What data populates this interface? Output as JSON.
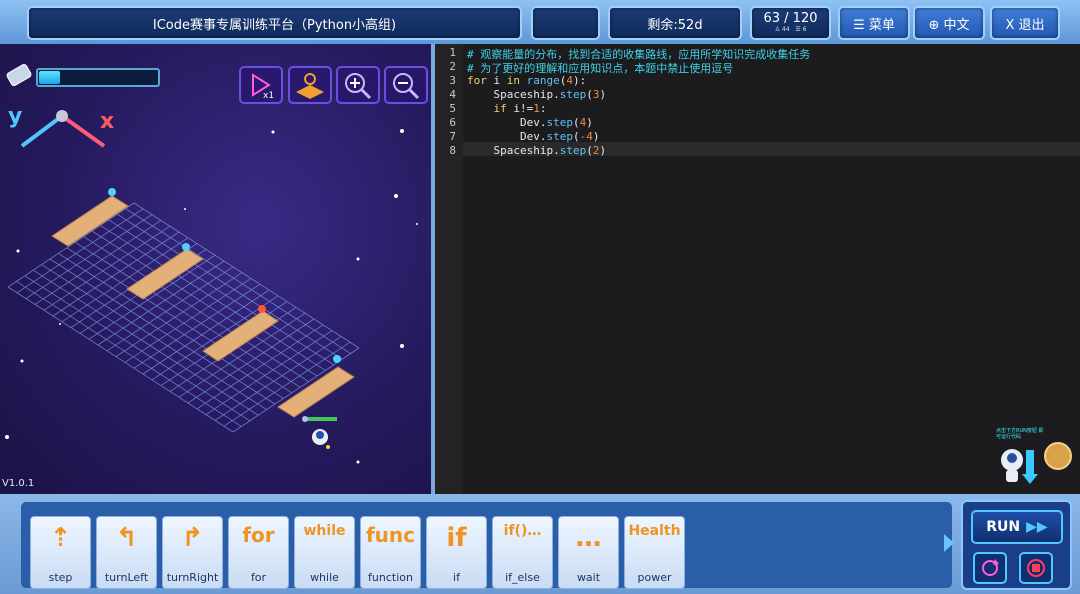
{
  "topbar": {
    "title": "ICode赛事专属训练平台（Python小高组)",
    "remaining": "剩余:52d",
    "score": "63 / 120",
    "score_detail_a": "44",
    "score_detail_b": "6",
    "menu": "☰ 菜单",
    "language": "⊕ 中文",
    "exit": "X 退出"
  },
  "game": {
    "version": "V1.0.1",
    "axis_x": "x",
    "axis_y": "y",
    "energy_progress": 0.18,
    "icons": [
      "play-speed-icon",
      "map-icon",
      "zoom-in-icon",
      "zoom-out-icon"
    ]
  },
  "editor": {
    "lines": [
      {
        "num": "1",
        "text": "# 观察能量的分布，找到合适的收集路线，应用所学知识完成收集任务"
      },
      {
        "num": "2",
        "text": "# 为了更好的理解和应用知识点，本题中禁止使用逗号"
      },
      {
        "num": "3",
        "text": "for i in range(4):"
      },
      {
        "num": "4",
        "text": "    Spaceship.step(3)"
      },
      {
        "num": "5",
        "text": "    if i!=1:"
      },
      {
        "num": "6",
        "text": "        Dev.step(4)"
      },
      {
        "num": "7",
        "text": "        Dev.step(-4)"
      },
      {
        "num": "8",
        "text": "    Spaceship.step(2)"
      }
    ]
  },
  "hint": {
    "text": "点击下方RUN按钮 即可运行代码"
  },
  "palette": {
    "blocks": [
      {
        "label": "step",
        "icon": "⇡"
      },
      {
        "label": "turnLeft",
        "icon": "↰"
      },
      {
        "label": "turnRight",
        "icon": "↱"
      },
      {
        "label": "for",
        "icon": "for"
      },
      {
        "label": "while",
        "icon": "while"
      },
      {
        "label": "function",
        "icon": "func"
      },
      {
        "label": "if",
        "icon": "if"
      },
      {
        "label": "if_else",
        "icon": "if()…"
      },
      {
        "label": "wait",
        "icon": "…"
      },
      {
        "label": "power",
        "icon": "Health"
      }
    ]
  },
  "run": {
    "label": "RUN"
  },
  "colors": {
    "accent": "#4fc8ff",
    "code_comment": "#3fd0e8",
    "code_keyword": "#f0d070",
    "code_method": "#62c1f0",
    "code_number": "#f28b3a"
  }
}
